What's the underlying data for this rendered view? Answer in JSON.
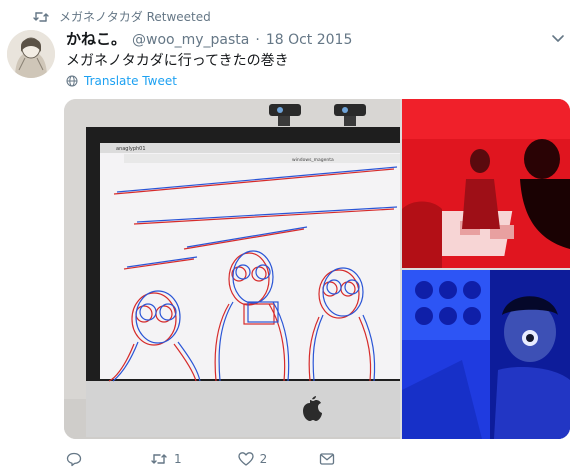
{
  "retweet_banner": {
    "text": "メガネノタカダ Retweeted"
  },
  "tweet": {
    "display_name": "かねこ。",
    "handle": "@woo_my_pasta",
    "separator": "·",
    "date": "18 Oct 2015",
    "text": "メガネノタカダに行ってきたの巻き",
    "translate_label": "Translate Tweet"
  },
  "media": {
    "main": {
      "window_title": "anaglyph01",
      "sub_title": "windows_magenta"
    },
    "top_right": {
      "description": "red-lit room"
    },
    "bottom_right": {
      "description": "blue-lit person"
    }
  },
  "actions": {
    "reply": {
      "icon": "reply-icon",
      "count": ""
    },
    "retweet": {
      "icon": "retweet-icon",
      "count": "1"
    },
    "like": {
      "icon": "heart-icon",
      "count": "2"
    },
    "dm": {
      "icon": "envelope-icon"
    }
  },
  "colors": {
    "muted": "#657786",
    "link": "#1da1f2",
    "text": "#14171a"
  }
}
